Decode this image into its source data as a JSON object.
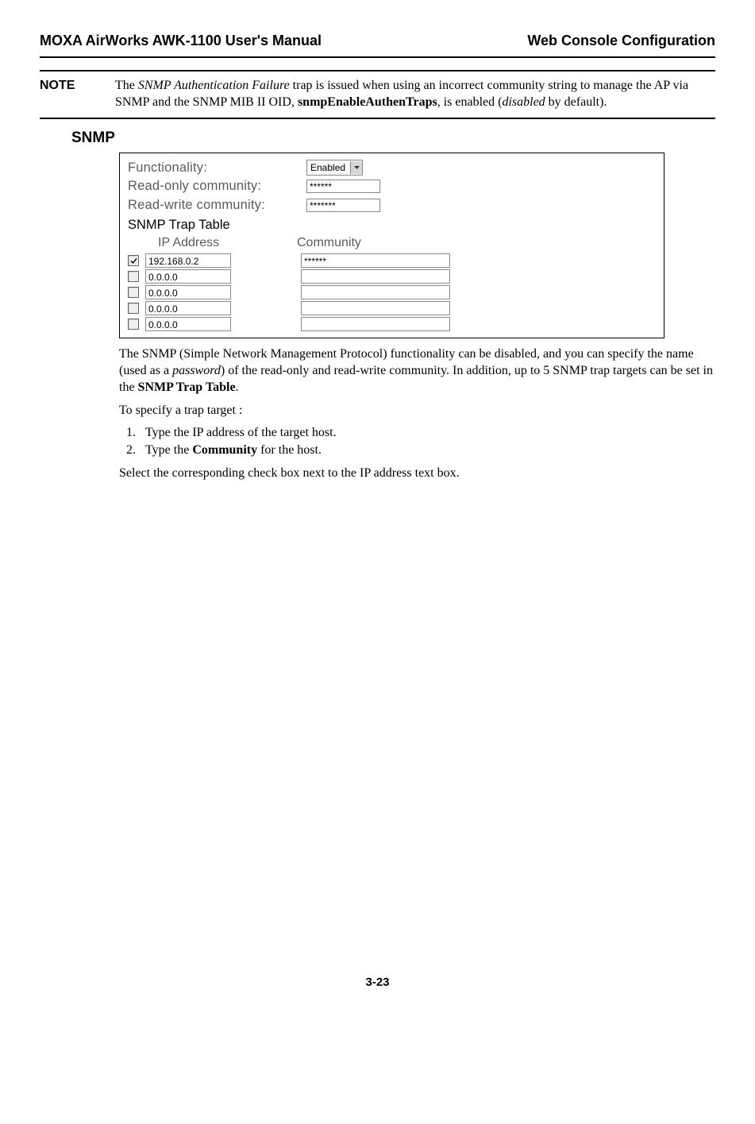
{
  "header": {
    "left": "MOXA AirWorks AWK-1100 User's Manual",
    "right": "Web Console Configuration"
  },
  "note": {
    "label": "NOTE",
    "text_before_italic": "The ",
    "italic1": "SNMP Authentication Failure",
    "text_mid": " trap is issued when using an incorrect community string to manage the AP via SNMP and the SNMP MIB II OID, ",
    "bold1": "snmpEnableAuthenTraps",
    "text_after_bold": ", is enabled (",
    "italic2": "disabled",
    "text_end": " by default)."
  },
  "section_heading": "SNMP",
  "form": {
    "functionality_label": "Functionality:",
    "functionality_value": "Enabled",
    "ro_label": "Read-only community:",
    "ro_value": "******",
    "rw_label": "Read-write community:",
    "rw_value": "*******",
    "trap_title": "SNMP Trap Table",
    "header_ip": "IP Address",
    "header_comm": "Community",
    "rows": [
      {
        "checked": true,
        "ip": "192.168.0.2",
        "comm": "******"
      },
      {
        "checked": false,
        "ip": "0.0.0.0",
        "comm": ""
      },
      {
        "checked": false,
        "ip": "0.0.0.0",
        "comm": ""
      },
      {
        "checked": false,
        "ip": "0.0.0.0",
        "comm": ""
      },
      {
        "checked": false,
        "ip": "0.0.0.0",
        "comm": ""
      }
    ]
  },
  "para1_pre": "The SNMP (Simple Network Management Protocol) functionality can be disabled, and you can specify the name (used as a ",
  "para1_italic": "password",
  "para1_mid": ") of the read-only and read-write community. In addition, up to 5 SNMP trap targets can be set in the ",
  "para1_bold": "SNMP Trap Table",
  "para1_end": ".",
  "para2": "To specify a trap target :",
  "step1": "Type the IP address of the target host.",
  "step2_pre": "Type the ",
  "step2_bold": "Community",
  "step2_end": " for the host.",
  "para3": "Select the corresponding check box next to the IP address text box.",
  "page_num": "3-23"
}
